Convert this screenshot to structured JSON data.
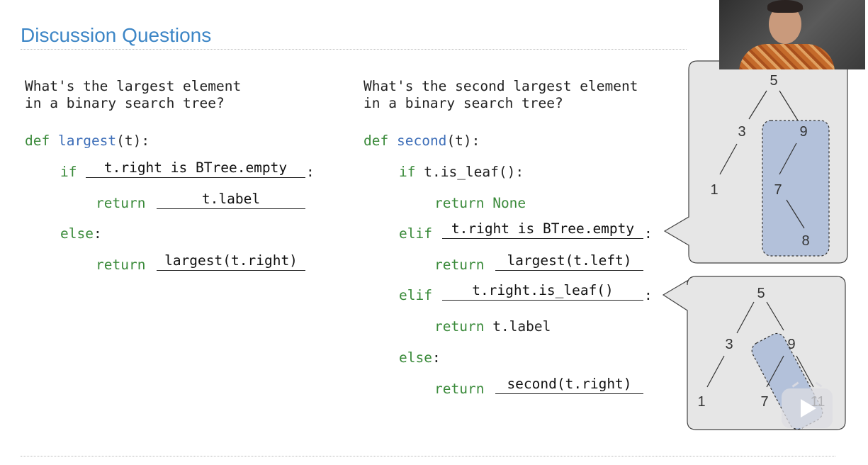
{
  "title": "Discussion Questions",
  "left": {
    "question_line1": "What's the largest element",
    "question_line2": "in a binary search tree?",
    "def_kw": "def",
    "def_fn": "largest",
    "def_params": "(t):",
    "if_kw": "if",
    "blank_if": "t.right is BTree.empty",
    "colon": ":",
    "return_kw": "return",
    "blank_return1": "t.label",
    "else_kw": "else",
    "blank_return2": "largest(t.right)"
  },
  "right": {
    "question_line1": "What's the second largest element",
    "question_line2": "in a binary search tree?",
    "def_kw": "def",
    "def_fn": "second",
    "def_params": "(t):",
    "if_kw": "if",
    "if_cond": "t.is_leaf():",
    "return_kw": "return",
    "return_none": "None",
    "elif_kw": "elif",
    "blank_elif1": "t.right is BTree.empty",
    "blank_return_left": "largest(t.left)",
    "blank_elif2": "t.right.is_leaf()",
    "return_label": "t.label",
    "else_kw": "else",
    "blank_return_second": "second(t.right)",
    "colon": ":"
  },
  "tree1": {
    "n5": "5",
    "n3": "3",
    "n9": "9",
    "n1": "1",
    "n7": "7",
    "n8": "8"
  },
  "tree2": {
    "n5": "5",
    "n3": "3",
    "n9": "9",
    "n1": "1",
    "n7": "7",
    "n11": "11"
  },
  "colors": {
    "title": "#3d86c6",
    "keyword": "#3a8a3a",
    "function": "#3d6eb8",
    "highlight": "#b3c1da",
    "bubble": "#e6e6e6"
  }
}
